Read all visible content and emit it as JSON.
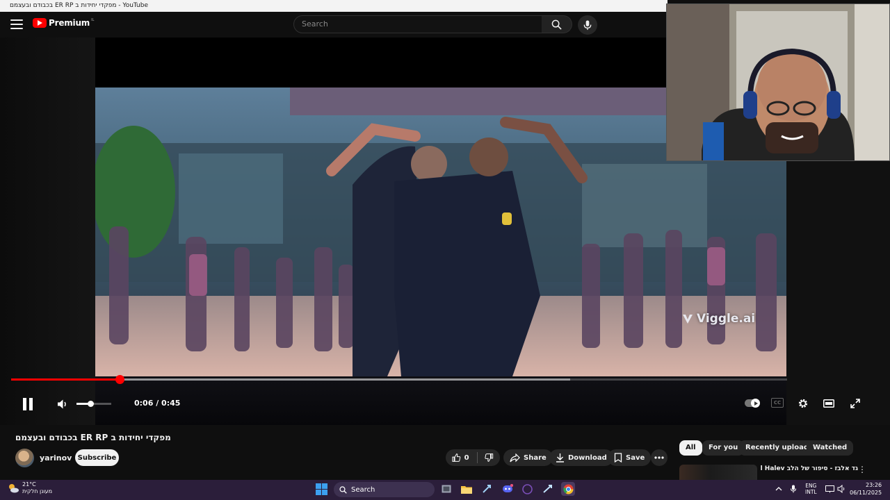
{
  "window": {
    "title": "בכבודם ובעצמם ER RP מפקדי יחידות ב - YouTube"
  },
  "masthead": {
    "logo_text": "Premium",
    "logo_superscript": "IL",
    "search_placeholder": "Search"
  },
  "player": {
    "watermark": "Viggle.ai",
    "current_time": "0:06",
    "duration": "0:45",
    "time_display": "0:06 / 0:45",
    "played_fraction": 0.14,
    "buffered_fraction": 0.72,
    "volume_fraction": 0.4,
    "state": "playing",
    "accent_color": "#ff0000"
  },
  "video": {
    "title": "בכבודם ובעצמם ER RP מפקדי יחידות ב",
    "channel": "yarinov",
    "subscribe_label": "Subscribe",
    "like_count": "0",
    "share_label": "Share",
    "download_label": "Download",
    "save_label": "Save"
  },
  "filters": [
    "All",
    "For you",
    "Recently uploaded",
    "Watched"
  ],
  "recommendation": {
    "title": "גד אלבז - סיפור של הלב Gad Elbaz - Sipur Shel Halev"
  },
  "taskbar": {
    "weather_temp": "21°C",
    "weather_desc": "מעונן חלקית",
    "search_label": "Search",
    "lang_line1": "ENG",
    "lang_line2": "INTL",
    "time": "23:26",
    "date": "06/11/2025",
    "background": "#2b1e3a"
  }
}
